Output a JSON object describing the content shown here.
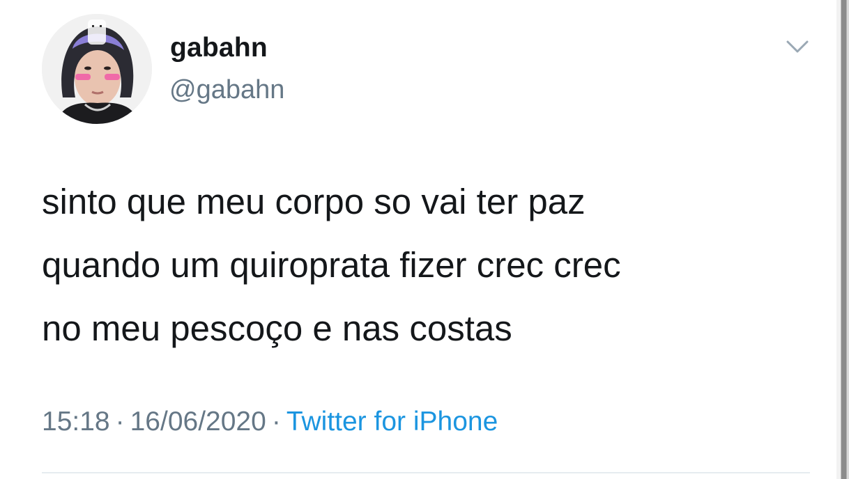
{
  "tweet": {
    "author": {
      "display_name": "gabahn",
      "handle": "@gabahn"
    },
    "text_lines": [
      "sinto que meu corpo so vai ter paz",
      "quando um quiroprata fizer crec crec",
      "no meu pescoço e nas costas"
    ],
    "meta": {
      "time": "15:18",
      "separator": "·",
      "date": "16/06/2020",
      "source": "Twitter for iPhone"
    },
    "icons": {
      "menu": "chevron-down-icon"
    },
    "colors": {
      "text": "#14171a",
      "secondary": "#657786",
      "link": "#1b95e0",
      "divider": "#e6ecf0"
    }
  }
}
